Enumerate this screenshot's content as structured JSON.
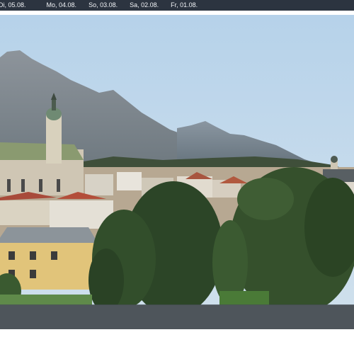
{
  "date_nav": {
    "items": [
      {
        "label": "Di, 05.08."
      },
      {
        "label": "Mo, 04.08."
      },
      {
        "label": "So, 03.08."
      },
      {
        "label": "Sa, 02.08."
      },
      {
        "label": "Fr, 01.08."
      }
    ]
  },
  "colors": {
    "topbar_bg": "#2c3440",
    "sky": "#bcd5e8",
    "mountain": "#6f7884",
    "tree": "#2f4a26",
    "overlay": "#464e56"
  }
}
